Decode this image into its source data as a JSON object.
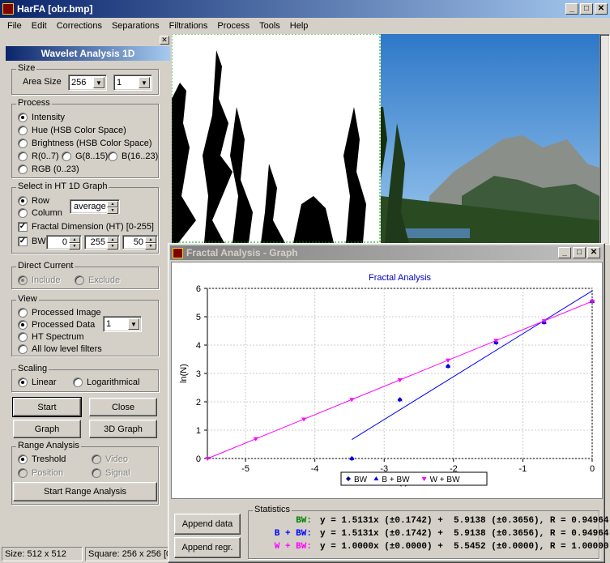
{
  "window": {
    "title": "HarFA [obr.bmp]"
  },
  "menu": [
    "File",
    "Edit",
    "Corrections",
    "Separations",
    "Filtrations",
    "Process",
    "Tools",
    "Help"
  ],
  "panel": {
    "title": "Wavelet Analysis 1D",
    "size": {
      "label": "Size",
      "area_label": "Area Size",
      "area_value": "256",
      "area_value2": "1"
    },
    "process": {
      "label": "Process",
      "options": [
        "Intensity",
        "Hue (HSB Color Space)",
        "Brightness (HSB Color Space)",
        "R(0..7)",
        "G(8..15)",
        "B(16..23)",
        "RGB (0..23)"
      ],
      "selected": "Intensity"
    },
    "select_ht": {
      "label": "Select in HT 1D Graph",
      "row": "Row",
      "column": "Column",
      "mode": "average",
      "fractal_dim": "Fractal Dimension (HT) [0-255]",
      "bw": "BW",
      "bw_v1": "0",
      "bw_v2": "255",
      "bw_v3": "50"
    },
    "direct_current": {
      "label": "Direct Current",
      "include": "Include",
      "exclude": "Exclude"
    },
    "view": {
      "label": "View",
      "options": [
        "Processed Image",
        "Processed Data",
        "HT Spectrum",
        "All low level filters"
      ],
      "selected": "Processed Data",
      "combo_value": "1"
    },
    "scaling": {
      "label": "Scaling",
      "linear": "Linear",
      "log": "Logarithmical"
    },
    "buttons": {
      "start": "Start",
      "close": "Close",
      "graph": "Graph",
      "graph3d": "3D Graph"
    },
    "range": {
      "label": "Range Analysis",
      "treshold": "Treshold",
      "video": "Video",
      "position": "Position",
      "signal": "Signal",
      "start": "Start Range Analysis"
    }
  },
  "status": {
    "size": "Size: 512 x 512",
    "square": "Square: 256 x 256 [0"
  },
  "graph_window": {
    "title": "Fractal Analysis - Graph",
    "append_data": "Append data",
    "append_regr": "Append regr.",
    "statistics_label": "Statistics",
    "stats": [
      {
        "name": "BW:",
        "eq": "y = 1.5131x (±0.1742) +  5.9138 (±0.3656), R = 0.94964",
        "color": "#008000"
      },
      {
        "name": "B + BW:",
        "eq": "y = 1.5131x (±0.1742) +  5.9138 (±0.3656), R = 0.94964",
        "color": "#0000ff"
      },
      {
        "name": "W + BW:",
        "eq": "y = 1.0000x (±0.0000) +  5.5452 (±0.0000), R = 1.00000",
        "color": "#ff00ff"
      }
    ]
  },
  "chart_data": {
    "type": "scatter",
    "title": "Fractal Analysis",
    "xlabel": "ln(r)",
    "ylabel": "ln(N)",
    "xlim": [
      -5.55,
      0
    ],
    "ylim": [
      0,
      6
    ],
    "xticks": [
      -5,
      -4,
      -3,
      -2,
      -1,
      0
    ],
    "yticks": [
      0,
      1,
      2,
      3,
      4,
      5,
      6
    ],
    "grid": true,
    "legend": "bottom",
    "series": [
      {
        "name": "BW",
        "color": "#000080",
        "marker": "diamond",
        "x": [
          -3.466,
          -2.773,
          -2.079,
          -1.386,
          -0.693,
          0
        ],
        "y": [
          0.0,
          2.079,
          3.258,
          4.094,
          4.804,
          5.545
        ],
        "fit": null
      },
      {
        "name": "B + BW",
        "color": "#0000ff",
        "marker": "triangle",
        "x": [
          -3.466,
          -2.773,
          -2.079,
          -1.386,
          -0.693,
          0
        ],
        "y": [
          0.0,
          2.079,
          3.258,
          4.094,
          4.804,
          5.545
        ],
        "fit": {
          "slope": 1.5131,
          "intercept": 5.9138,
          "xrange": [
            -3.466,
            0
          ]
        }
      },
      {
        "name": "W + BW",
        "color": "#ff00ff",
        "marker": "triangle-down",
        "x": [
          -5.545,
          -4.852,
          -4.159,
          -3.466,
          -2.773,
          -2.079,
          -1.386,
          -0.693,
          0
        ],
        "y": [
          0.0,
          0.693,
          1.386,
          2.079,
          2.773,
          3.466,
          4.159,
          4.852,
          5.545
        ],
        "fit": {
          "slope": 1.0,
          "intercept": 5.5452,
          "xrange": [
            -5.545,
            0
          ]
        }
      }
    ]
  }
}
